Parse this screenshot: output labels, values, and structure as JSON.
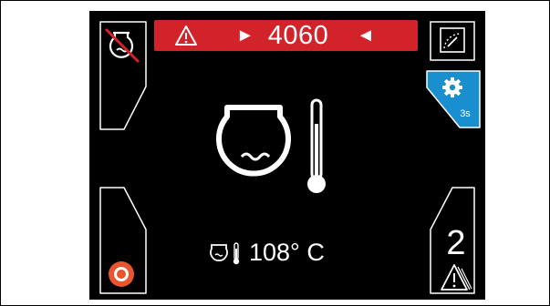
{
  "alarm": {
    "value": "4060",
    "color": "#d2232a",
    "icon": "warning-triangle-icon"
  },
  "center": {
    "icon": "tank-thermometer-icon"
  },
  "temperature": {
    "readout": "108° C",
    "icon": "tank-temperature-small-icon"
  },
  "left_top_button": {
    "icon": "tank-disabled-icon"
  },
  "left_bottom_button": {
    "icon": "stop-record-icon",
    "color": "#e8552e"
  },
  "right_top_button": {
    "icon": "gauge-icon"
  },
  "right_settings_button": {
    "icon": "gear-icon",
    "hold_label": "3s",
    "color": "#1a8fd0"
  },
  "right_bottom_button": {
    "count": "2",
    "icon": "stacked-warnings-icon"
  }
}
